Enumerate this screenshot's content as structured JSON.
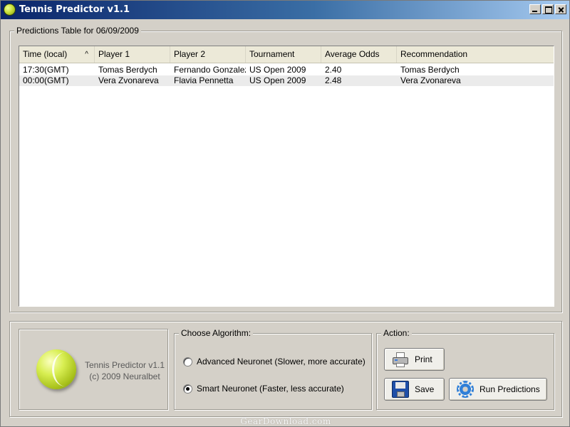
{
  "window": {
    "title": "Tennis Predictor v1.1"
  },
  "predictions": {
    "group_label": "Predictions Table for 06/09/2009",
    "columns": [
      "Time (local)",
      "Player 1",
      "Player 2",
      "Tournament",
      "Average Odds",
      "Recommendation"
    ],
    "sort_indicator": "^",
    "rows": [
      [
        "17:30(GMT)",
        "Tomas Berdych",
        "Fernando Gonzalez",
        "US Open 2009",
        "2.40",
        "Tomas Berdych"
      ],
      [
        "00:00(GMT)",
        "Vera Zvonareva",
        "Flavia Pennetta",
        "US Open 2009",
        "2.48",
        "Vera Zvonareva"
      ]
    ]
  },
  "about": {
    "line1": "Tennis Predictor v1.1",
    "line2": "(c) 2009 Neuralbet"
  },
  "algorithm": {
    "group_label": "Choose Algorithm:",
    "options": [
      {
        "label": "Advanced Neuronet  (Slower, more accurate)",
        "selected": false
      },
      {
        "label": "Smart Neuronet  (Faster, less accurate)",
        "selected": true
      }
    ]
  },
  "action": {
    "group_label": "Action:",
    "print_label": "Print",
    "save_label": "Save",
    "run_label": "Run Predictions"
  },
  "watermark": "GearDownload.com",
  "icons": {
    "app": "tennis-ball-icon",
    "print": "printer-icon",
    "save": "floppy-disk-icon",
    "run": "gear-icon"
  }
}
